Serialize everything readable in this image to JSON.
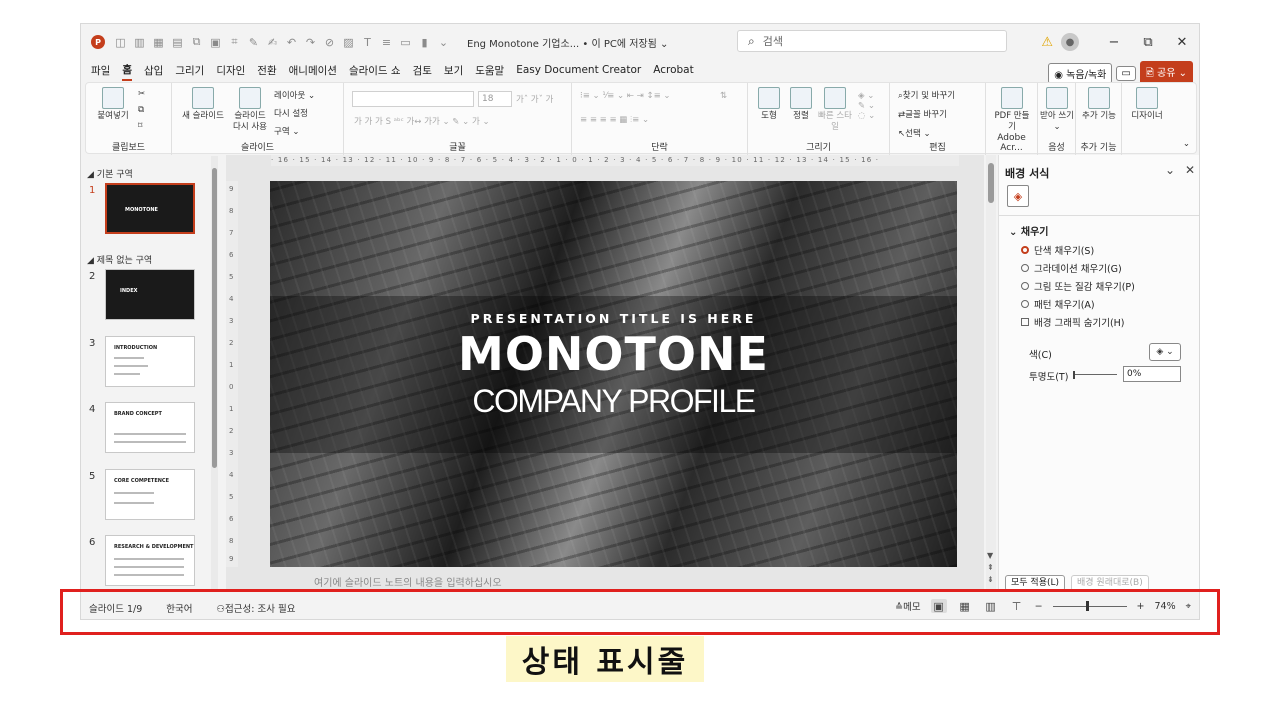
{
  "titlebar": {
    "app_icon": "powerpoint-icon",
    "document_title": "Eng Monotone 기업소... • 이 PC에 저장됨 ⌄",
    "search_placeholder": "검색",
    "warning_icon": "warning-icon",
    "minimize": "−",
    "restore": "⧉",
    "close": "✕"
  },
  "menu": {
    "tabs": [
      "파일",
      "홈",
      "삽입",
      "그리기",
      "디자인",
      "전환",
      "애니메이션",
      "슬라이드 쇼",
      "검토",
      "보기",
      "도움말",
      "Easy Document Creator",
      "Acrobat"
    ],
    "active_tab": "홈",
    "record_label": "◉ 녹음/녹화",
    "comment_icon": "comment-icon",
    "share_label": "🖻 공유 ⌄"
  },
  "ribbon": {
    "clipboard": {
      "group": "클립보드",
      "paste": "붙여넣기"
    },
    "slides": {
      "group": "슬라이드",
      "new_slide": "새 슬라이드",
      "reuse": "슬라이드 다시 사용",
      "layout": "레이아웃 ⌄",
      "reset": "다시 설정",
      "section": "구역 ⌄"
    },
    "font": {
      "group": "글꼴",
      "size": "18"
    },
    "paragraph": {
      "group": "단락"
    },
    "drawing": {
      "group": "그리기",
      "shape": "도형",
      "arrange": "정렬",
      "quick_style": "빠른 스타일"
    },
    "editing": {
      "group": "편집",
      "find": "찾기 및 바꾸기",
      "replace_font": "글꼴 바꾸기",
      "select": "선택 ⌄"
    },
    "adobe": {
      "group": "Adobe Acr...",
      "pdf": "PDF 만들기"
    },
    "voice": {
      "group": "음성",
      "dictate": "받아 쓰기 ⌄"
    },
    "addins": {
      "group": "추가 기능",
      "addins": "추가 기능"
    },
    "designer": {
      "label": "디자이너"
    }
  },
  "slides_panel": {
    "sections": [
      "기본 구역",
      "제목 없는 구역"
    ],
    "slides": [
      {
        "num": "1",
        "title": "MONOTONE"
      },
      {
        "num": "2",
        "title": "INDEX"
      },
      {
        "num": "3",
        "title": "INTRODUCTION"
      },
      {
        "num": "4",
        "title": "BRAND CONCEPT"
      },
      {
        "num": "5",
        "title": "CORE COMPETENCE"
      },
      {
        "num": "6",
        "title": "RESEARCH & DEVELOPMENT"
      }
    ]
  },
  "slide": {
    "subtitle": "PRESENTATION TITLE IS HERE",
    "title": "MONOTONE",
    "company": "COMPANY PROFILE",
    "notes_placeholder": "여기에 슬라이드 노트의 내용을 입력하십시오"
  },
  "format_pane": {
    "title": "배경 서식",
    "section": "채우기",
    "options": [
      "단색 채우기(S)",
      "그라데이션 채우기(G)",
      "그림 또는 질감 채우기(P)",
      "패턴 채우기(A)"
    ],
    "selected_option": "단색 채우기(S)",
    "hide_graphics": "배경 그래픽 숨기기(H)",
    "color_label": "색(C)",
    "transparency_label": "투명도(T)",
    "transparency_value": "0%",
    "transparency_fraction": 0,
    "apply_all": "모두 적용(L)",
    "reset_background": "배경 원래대로(B)"
  },
  "statusbar": {
    "slide_counter": "슬라이드 1/9",
    "language": "한국어",
    "accessibility": "접근성: 조사 필요",
    "notes_btn": "≙메모",
    "zoom_minus": "−",
    "zoom_plus": "+",
    "zoom_level": "74%"
  },
  "callout": {
    "caption": "상태 표시줄",
    "highlight_color": "#e0201e"
  },
  "colors": {
    "accent": "#c43e1c",
    "caption_bg": "#fdf7c8"
  }
}
